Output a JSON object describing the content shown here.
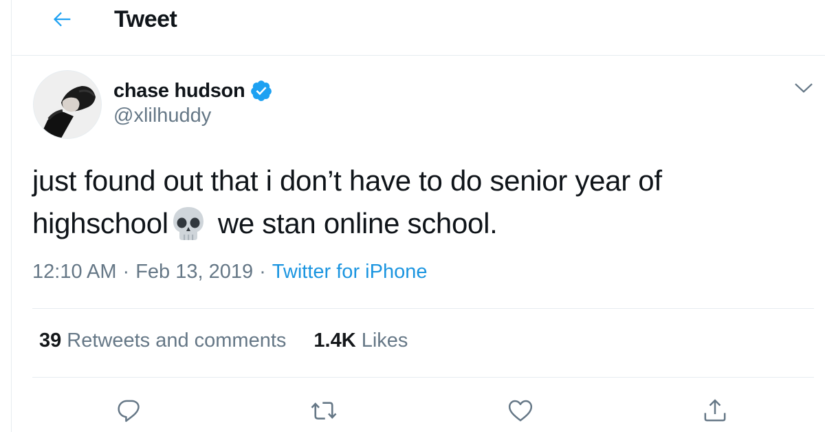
{
  "header": {
    "title": "Tweet",
    "back_icon": "arrow-left-icon"
  },
  "author": {
    "display_name": "chase hudson",
    "handle": "@xlilhuddy",
    "verified": true,
    "verified_icon": "verified-badge-icon",
    "avatar": "avatar-photo"
  },
  "tweet": {
    "line1": "just found out that i don’t have to do senior year of",
    "line2_before_emoji": "highschool",
    "emoji": "skull-emoji",
    "line2_after_emoji": "we stan online school.",
    "time": "12:10 AM",
    "separator": "·",
    "date": "Feb 13, 2019",
    "source": "Twitter for iPhone"
  },
  "stats": {
    "retweets_count": "39",
    "retweets_label": "Retweets and comments",
    "likes_count": "1.4K",
    "likes_label": "Likes"
  },
  "actions": [
    {
      "name": "reply",
      "icon": "reply-icon"
    },
    {
      "name": "retweet",
      "icon": "retweet-icon"
    },
    {
      "name": "like",
      "icon": "heart-icon"
    },
    {
      "name": "share",
      "icon": "share-icon"
    }
  ],
  "colors": {
    "accent": "#1da1f2",
    "link": "#1b95e0",
    "secondary_text": "#657786",
    "primary_text": "#0f1419",
    "border": "#e6ecf0"
  }
}
